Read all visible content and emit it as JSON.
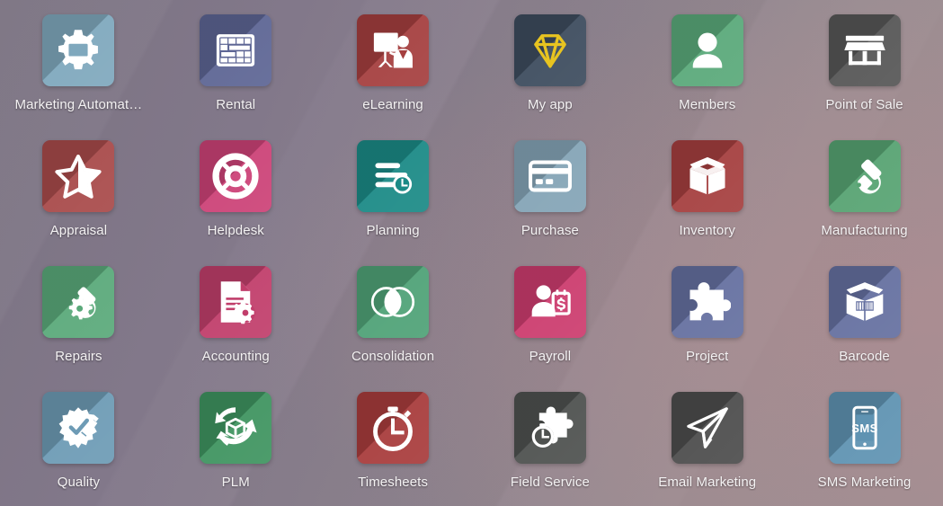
{
  "launcher": {
    "background_left": "#7b7382",
    "background_right": "#a18f92",
    "label_color": "#f4f2f3",
    "columns": 6,
    "rows": 4
  },
  "apps": [
    {
      "label": "Marketing Automat…",
      "full_label": "Marketing Automation",
      "icon": "gear-envelope-icon",
      "color": "#7fa8bd",
      "glyph_color": "#ffffff"
    },
    {
      "label": "Rental",
      "full_label": "Rental",
      "icon": "calendar-gantt-icon",
      "color": "#5d6594",
      "glyph_color": "#ffffff"
    },
    {
      "label": "eLearning",
      "full_label": "eLearning",
      "icon": "presentation-teacher-icon",
      "color": "#a53f3f",
      "glyph_color": "#ffffff"
    },
    {
      "label": "My app",
      "full_label": "My app",
      "icon": "diamond-icon",
      "color": "#3d4c5e",
      "glyph_color": "#e8c420"
    },
    {
      "label": "Members",
      "full_label": "Members",
      "icon": "person-icon",
      "color": "#5aa97a",
      "glyph_color": "#ffffff"
    },
    {
      "label": "Point of Sale",
      "full_label": "Point of Sale",
      "icon": "storefront-icon",
      "color": "#565656",
      "glyph_color": "#ffffff"
    },
    {
      "label": "Appraisal",
      "full_label": "Appraisal",
      "icon": "half-star-icon",
      "color": "#a84a4a",
      "glyph_color": "#ffffff"
    },
    {
      "label": "Helpdesk",
      "full_label": "Helpdesk",
      "icon": "lifebuoy-icon",
      "color": "#cc4277",
      "glyph_color": "#ffffff"
    },
    {
      "label": "Planning",
      "full_label": "Planning",
      "icon": "bars-clock-icon",
      "color": "#1b8a86",
      "glyph_color": "#ffffff"
    },
    {
      "label": "Purchase",
      "full_label": "Purchase",
      "icon": "credit-card-icon",
      "color": "#84a4b6",
      "glyph_color": "#ffffff"
    },
    {
      "label": "Inventory",
      "full_label": "Inventory",
      "icon": "open-box-icon",
      "color": "#a53f3f",
      "glyph_color": "#ffffff"
    },
    {
      "label": "Manufacturing",
      "full_label": "Manufacturing",
      "icon": "wrench-icon",
      "color": "#57a372",
      "glyph_color": "#ffffff"
    },
    {
      "label": "Repairs",
      "full_label": "Repairs",
      "icon": "wrench-gear-icon",
      "color": "#5aa97a",
      "glyph_color": "#ffffff"
    },
    {
      "label": "Accounting",
      "full_label": "Accounting",
      "icon": "document-gear-icon",
      "color": "#c13e6b",
      "glyph_color": "#ffffff"
    },
    {
      "label": "Consolidation",
      "full_label": "Consolidation",
      "icon": "venn-circles-icon",
      "color": "#4fa277",
      "glyph_color": "#ffffff"
    },
    {
      "label": "Payroll",
      "full_label": "Payroll",
      "icon": "person-dollar-icon",
      "color": "#cc3c6e",
      "glyph_color": "#ffffff"
    },
    {
      "label": "Project",
      "full_label": "Project",
      "icon": "puzzle-piece-icon",
      "color": "#6570a0",
      "glyph_color": "#ffffff"
    },
    {
      "label": "Barcode",
      "full_label": "Barcode",
      "icon": "box-barcode-icon",
      "color": "#6570a0",
      "glyph_color": "#ffffff"
    },
    {
      "label": "Quality",
      "full_label": "Quality",
      "icon": "badge-pencil-icon",
      "color": "#6d9bb5",
      "glyph_color": "#ffffff"
    },
    {
      "label": "PLM",
      "full_label": "PLM",
      "icon": "recycle-box-icon",
      "color": "#3f9460",
      "glyph_color": "#ffffff"
    },
    {
      "label": "Timesheets",
      "full_label": "Timesheets",
      "icon": "stopwatch-icon",
      "color": "#a83c3c",
      "glyph_color": "#ffffff"
    },
    {
      "label": "Field Service",
      "full_label": "Field Service",
      "icon": "puzzle-stopwatch-icon",
      "color": "#4e514f",
      "glyph_color": "#ffffff"
    },
    {
      "label": "Email Marketing",
      "full_label": "Email Marketing",
      "icon": "paper-plane-icon",
      "color": "#4d4d4d",
      "glyph_color": "#ffffff"
    },
    {
      "label": "SMS Marketing",
      "full_label": "SMS Marketing",
      "icon": "mobile-sms-icon",
      "color": "#5f93b2",
      "glyph_color": "#ffffff"
    }
  ]
}
